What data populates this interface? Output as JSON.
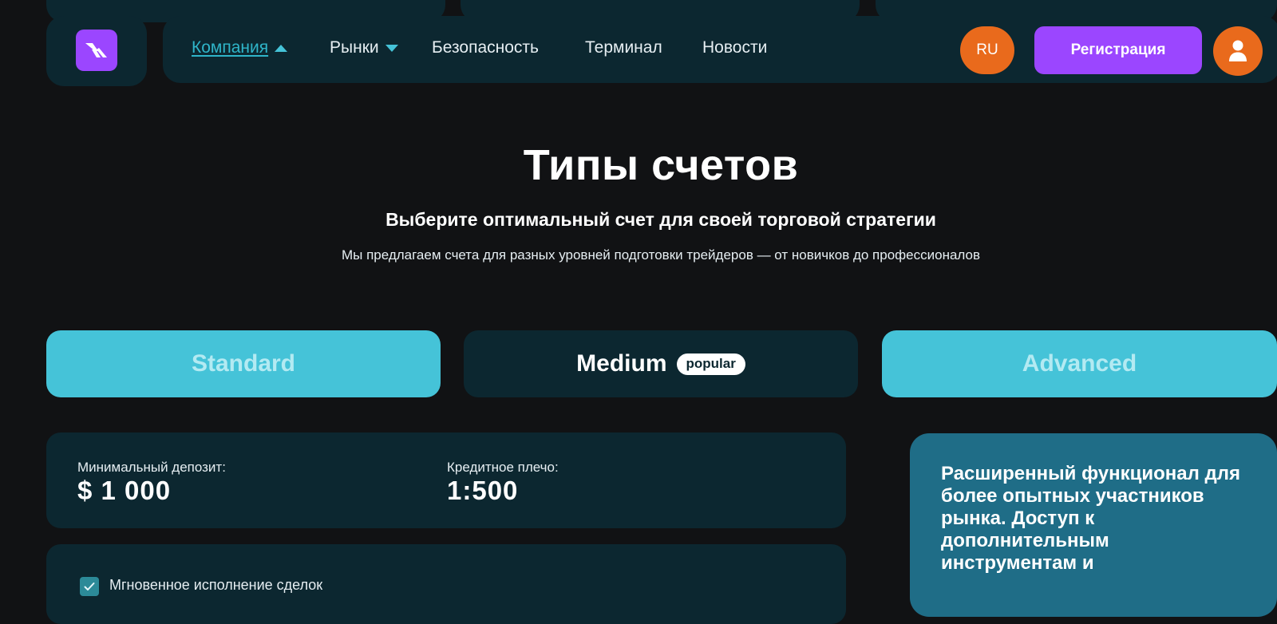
{
  "nav": {
    "items": [
      {
        "label": "Компания"
      },
      {
        "label": "Рынки"
      },
      {
        "label": "Безопасность"
      },
      {
        "label": "Терминал"
      },
      {
        "label": "Новости"
      }
    ],
    "lang": "RU",
    "register": "Регистрация",
    "icons": {
      "logo": "brand-logo",
      "user": "user-icon",
      "caret_up": "caret-up-icon",
      "caret_down": "caret-down-icon"
    }
  },
  "hero": {
    "title": "Типы счетов",
    "subtitle": "Выберите оптимальный счет для своей торговой стратегии",
    "description": "Мы предлагаем счета для разных уровней подготовки трейдеров — от новичков до профессионалов"
  },
  "tabs": [
    {
      "label": "Standard"
    },
    {
      "label": "Medium",
      "badge": "popular"
    },
    {
      "label": "Advanced"
    }
  ],
  "account": {
    "min_deposit_label": "Минимальный депозит:",
    "min_deposit_value": "$ 1 000",
    "leverage_label": "Кредитное плечо:",
    "leverage_value": "1:500",
    "features": [
      "Мгновенное исполнение сделок"
    ]
  },
  "advanced_description": "Расширенный функционал для более опытных участников рынка. Доступ к дополнительным инструментам и",
  "colors": {
    "background": "#111214",
    "panel": "#0c2730",
    "accent_cyan": "#45c3d8",
    "accent_purple": "#9b46ff",
    "accent_orange": "#e96a1c",
    "desc_card": "#1f6d87"
  }
}
